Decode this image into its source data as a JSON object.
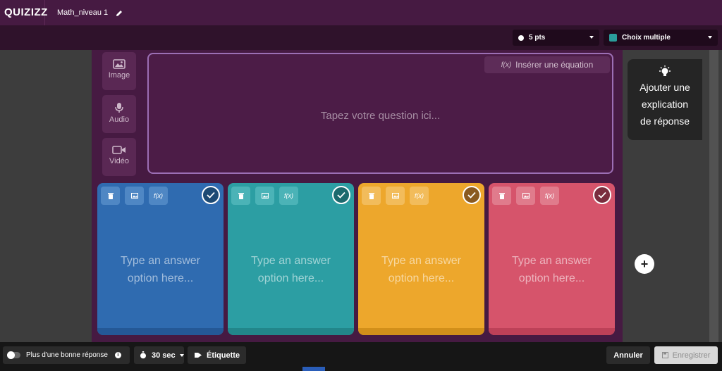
{
  "header": {
    "logo": "QUIZIZZ",
    "title": "Math_niveau 1"
  },
  "toolbar": {
    "points": "5 pts",
    "question_type": "Choix multiple"
  },
  "media": {
    "image": "Image",
    "audio": "Audio",
    "video": "Vidéo"
  },
  "question": {
    "placeholder": "Tapez votre question ici...",
    "equation_button": "Insérer une équation",
    "fx": "f(x)"
  },
  "answers": [
    {
      "placeholder_line1": "Type an answer",
      "placeholder_line2": "option here..."
    },
    {
      "placeholder_line1": "Type an answer",
      "placeholder_line2": "option here..."
    },
    {
      "placeholder_line1": "Type an answer",
      "placeholder_line2": "option here..."
    },
    {
      "placeholder_line1": "Type an answer",
      "placeholder_line2": "option here..."
    }
  ],
  "explanation": {
    "line1": "Ajouter une",
    "line2": "explication",
    "line3": "de réponse"
  },
  "add_option": "+",
  "footer": {
    "multiple_answers": "Plus d'une bonne réponse",
    "info": "i",
    "timer": "30 sec",
    "tag": "Étiquette",
    "cancel": "Annuler",
    "save": "Enregistrer"
  },
  "colors": {
    "blue": "#2f6bb0",
    "teal": "#2c9ea3",
    "yellow": "#eda72c",
    "red": "#d6546b",
    "purple": "#461a42"
  }
}
